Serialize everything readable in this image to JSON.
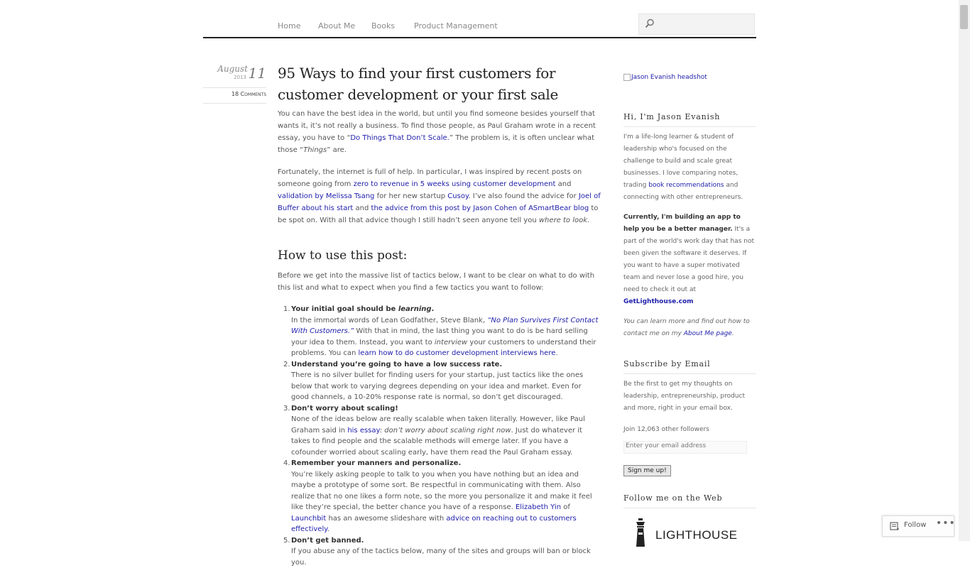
{
  "nav": {
    "items": [
      "Home",
      "About Me",
      "Books",
      "Product Management"
    ]
  },
  "post": {
    "month": "August",
    "year": "2013",
    "day": "11",
    "comments": "18 Comments",
    "title_line1": "95 Ways to find your first customers for",
    "title_line2": "customer development or your first sale",
    "intro": {
      "t1": "You can have the best idea in the world, but until you find someone besides yourself that wants it, it’s not really a business.  To find those people, as Paul Graham wrote in a recent essay, you have to “",
      "l1": "Do Things That Don’t Scale.",
      "t2": "” The problem is, it is often unclear what those “",
      "em1": "Things",
      "t3": "” are."
    },
    "para2": {
      "t1": "Fortunately, the internet is full of help. In particular, I was inspired by recent posts on someone going from ",
      "l1": "zero to revenue in 5 weeks using customer development",
      "t2": " and ",
      "l2": "validation by Melissa Tsang",
      "t3": " for her new startup ",
      "l3": "Cusoy",
      "t4": ". I’ve also found the advice for ",
      "l4": "Joel of Buffer about his start",
      "t5": " and ",
      "l5": "the advice from this post by Jason Cohen of ASmartBear blog",
      "t6": " to be spot on. With all that advice though I still hadn’t seen anyone tell you ",
      "em1": "where to look",
      "t7": "."
    },
    "h2": "How to use this post:",
    "para3": "Before we get into the massive list of tactics below, I want to be clear on what to do with this list and what to expect when you find a few tactics you want to follow:",
    "list": {
      "i1": {
        "num": "1.",
        "b1": "Your initial goal should be ",
        "bem": "learning",
        "b2": ".",
        "t1": "In the immortal words of Lean Godfather, Steve Blank, ",
        "l1": "“No Plan Survives First Contact With Customers.”",
        "t2": " With that in mind, the last thing you want to do is be hard selling your idea to them. Instead, you want to ",
        "em1": "interview",
        "t3": " your customers to understand their problems. You can ",
        "l2": "learn how to do customer development interviews here",
        "t4": "."
      },
      "i2": {
        "num": "2.",
        "b1": "Understand you’re going to have a low success rate.",
        "t1": "There is no silver bullet for finding users for your startup, just tactics like the ones below that work to varying degrees depending on your idea and market. Even for good channels, a 10-20% response rate is normal, so don’t get discouraged."
      },
      "i3": {
        "num": "3.",
        "b1": "Don’t worry about scaling!",
        "t1": "None of the ideas below are really scalable when taken literally. However, like Paul Graham said in ",
        "l1": "his essay",
        "t2": ": ",
        "em1": "don’t worry about scaling right now",
        "t3": ". Just do whatever it takes to find people and the scalable methods will emerge later. If you have a cofounder worried about scaling early, have them read the Paul Graham essay."
      },
      "i4": {
        "num": "4.",
        "b1": "Remember your manners and personalize.",
        "t1": "You’re likely asking people to talk to you when you have nothing but an idea and maybe a prototype of some sort. Be respectful in communicating with them. Also realize that no one likes a form note, so the more you personalize it and make it feel like they’re special, the better chance you have of a response. ",
        "l1": "Elizabeth Yin",
        "t2": " of ",
        "l2": "Launchbit",
        "t3": " has an awesome slideshare with ",
        "l3": "advice on reaching out to customers effectively",
        "t4": "."
      },
      "i5": {
        "num": "5.",
        "b1": "Don’t get banned.",
        "t1": "If you abuse any of the tactics below, many of the sites and groups will ban or block you."
      }
    }
  },
  "sidebar": {
    "headshot_alt": "Jason Evanish headshot",
    "hi_title": "Hi, I'm Jason Evanish",
    "bio": {
      "t1": "I'm a life-long learner & student of leadership who's focused on the challenge to build and scale great businesses. I love comparing notes, trading ",
      "l1": "book recommendations",
      "t2": " and connecting with other entrepreneurs."
    },
    "current": {
      "b1": "Currently, I'm building an app to help you be a better manager.",
      "t1": " It's a part of the world's work day that has not been given the software it deserves. If you want to have a super motivated team and never lose a good hire, you need to check it out at ",
      "l1": "GetLighthouse.com"
    },
    "learn": {
      "t1": "You can learn more and find out how to contact me on my ",
      "l1": "About Me page",
      "t2": "."
    },
    "subscribe_title": "Subscribe by Email",
    "subscribe_text": "Be the first to get my thoughts on leadership, entrepreneurship, product and more, right in your email box.",
    "followers": "Join 12,063 other followers",
    "email_placeholder": "Enter your email address",
    "signup_label": "Sign me up!",
    "follow_web_title": "Follow me on the Web",
    "logo_text": "LIGHTHOUSE"
  },
  "follow_bar": {
    "label": "Follow"
  }
}
